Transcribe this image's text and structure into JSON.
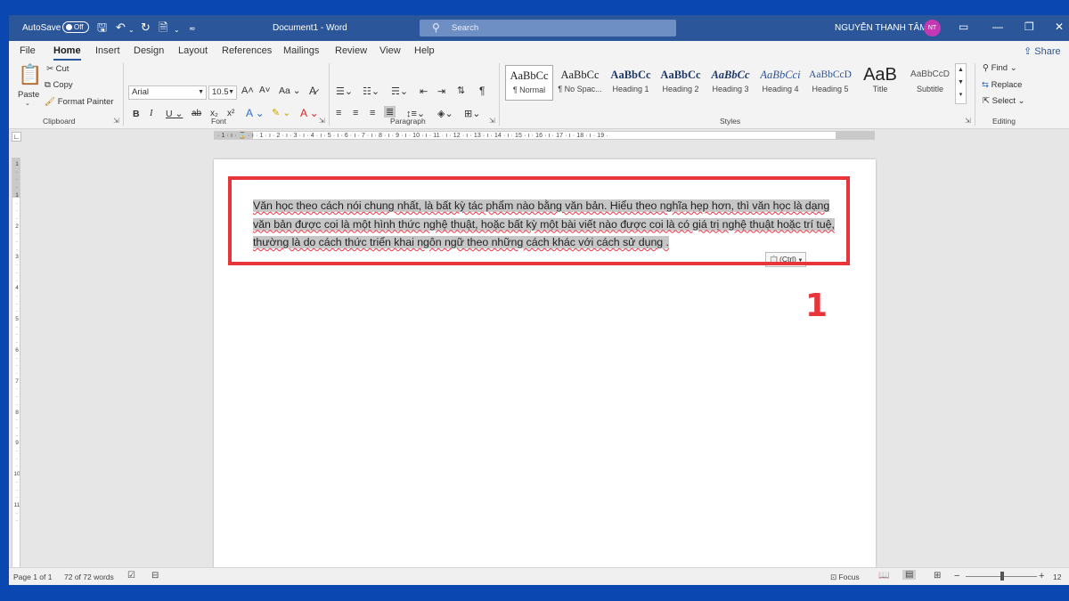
{
  "titlebar": {
    "autosave_label": "AutoSave",
    "autosave_state": "Off",
    "document_title": "Document1  -  Word",
    "search_placeholder": "Search",
    "user_name": "NGUYỄN THANH TÂM",
    "user_initials": "NT"
  },
  "menu_tabs": [
    "File",
    "Home",
    "Insert",
    "Design",
    "Layout",
    "References",
    "Mailings",
    "Review",
    "View",
    "Help"
  ],
  "active_tab": "Home",
  "share_label": "Share",
  "ribbon": {
    "clipboard": {
      "paste_label": "Paste",
      "cut_label": "Cut",
      "copy_label": "Copy",
      "format_painter_label": "Format Painter",
      "group_label": "Clipboard"
    },
    "font": {
      "font_name": "Arial",
      "font_size": "10.5",
      "change_case_label": "Aa",
      "group_label": "Font"
    },
    "paragraph": {
      "group_label": "Paragraph"
    },
    "styles": {
      "items": [
        {
          "preview": "AaBbCc",
          "name": "¶ Normal"
        },
        {
          "preview": "AaBbCc",
          "name": "¶ No Spac..."
        },
        {
          "preview": "AaBbCc",
          "name": "Heading 1"
        },
        {
          "preview": "AaBbCc",
          "name": "Heading 2"
        },
        {
          "preview": "AaBbCc",
          "name": "Heading 3"
        },
        {
          "preview": "AaBbCci",
          "name": "Heading 4"
        },
        {
          "preview": "AaBbCcD",
          "name": "Heading 5"
        },
        {
          "preview": "AaB",
          "name": "Title"
        },
        {
          "preview": "AaBbCcD",
          "name": "Subtitle"
        }
      ],
      "group_label": "Styles"
    },
    "editing": {
      "find_label": "Find",
      "replace_label": "Replace",
      "select_label": "Select",
      "group_label": "Editing"
    }
  },
  "ruler": {
    "horizontal_ticks": "· 1 · ı · ⌛ · ı · 1 · ı · 2 · ı · 3 · ı · 4 · ı · 5 · ı · 6 · ı · 7 · ı · 8 · ı · 9 · ı · 10 · ı · 11 · ı · 12 · ı · 13 · ı · 14 · ı · 15 · ı · 16 · ı · 17 · ı · 18 · ı · 19 ·",
    "vertical_ticks": [
      "1",
      "·",
      "·",
      "·",
      "1",
      "·",
      "·",
      "·",
      "2",
      "·",
      "·",
      "·",
      "3",
      "·",
      "·",
      "·",
      "4",
      "·",
      "·",
      "·",
      "5",
      "·",
      "·",
      "·",
      "6",
      "·",
      "·",
      "·",
      "7",
      "·",
      "·",
      "·",
      "8",
      "·",
      "·",
      "·",
      "9",
      "·",
      "·",
      "·",
      "10",
      "·",
      "·",
      "·",
      "11",
      "·",
      "·"
    ]
  },
  "document": {
    "selected_text": "Văn học theo cách nói chung nhất, là bất kỳ tác phẩm nào bằng văn bản. Hiểu theo nghĩa hẹp hơn, thì văn học là dạng văn bản được coi là một hình thức nghệ thuật, hoặc bất kỳ một bài viết nào được coi là có giá trị nghệ thuật hoặc trí tuệ, thường là do cách thức triển khai ngôn ngữ theo những cách khác với cách sử dụng .",
    "paste_options_label": "(Ctrl)"
  },
  "annotation": {
    "step_number": "1",
    "highlight_color": "#e8343b"
  },
  "statusbar": {
    "page_info": "Page 1 of 1",
    "word_count": "72 of 72 words",
    "focus_label": "Focus",
    "zoom_minus": "−",
    "zoom_plus": "+",
    "zoom_partial": "12"
  },
  "colors": {
    "word_blue": "#2b579a",
    "background_blue": "#0a47b0"
  }
}
